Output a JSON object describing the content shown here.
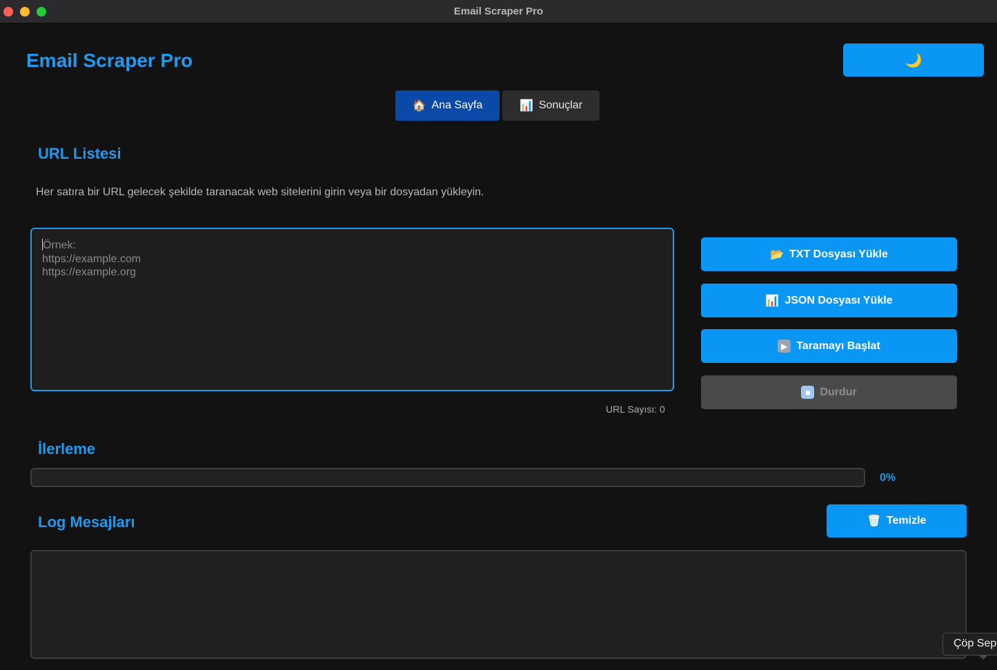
{
  "window": {
    "title": "Email Scraper Pro"
  },
  "header": {
    "app_title": "Email Scraper Pro",
    "theme_toggle_icon": "🌙"
  },
  "tabs": [
    {
      "icon": "🏠",
      "label": "Ana Sayfa",
      "active": true
    },
    {
      "icon": "📊",
      "label": "Sonuçlar",
      "active": false
    }
  ],
  "url_section": {
    "title": "URL Listesi",
    "description": "Her satıra bir URL gelecek şekilde taranacak web sitelerini girin veya bir dosyadan yükleyin.",
    "placeholder_first": "Örnek:",
    "placeholder_lines": [
      "https://example.com",
      "https://example.org"
    ],
    "url_count_label": "URL Sayısı: 0"
  },
  "actions": {
    "load_txt": {
      "icon": "📂",
      "label": "TXT Dosyası Yükle"
    },
    "load_json": {
      "icon": "📊",
      "label": "JSON Dosyası Yükle"
    },
    "start_scan": {
      "icon": "▶",
      "label": "Taramayı Başlat"
    },
    "stop": {
      "icon": "■",
      "label": "Durdur",
      "enabled": false
    }
  },
  "progress": {
    "title": "İlerleme",
    "value": 0,
    "label": "0%"
  },
  "log": {
    "title": "Log Mesajları",
    "clear_icon": "🗑",
    "clear_label": "Temizle"
  },
  "tooltip": {
    "text": "Çöp Sepeti"
  },
  "colors": {
    "accent": "#1e9bf0",
    "button": "#0a96f5",
    "active_tab": "#0b49a8",
    "background": "#121212"
  }
}
